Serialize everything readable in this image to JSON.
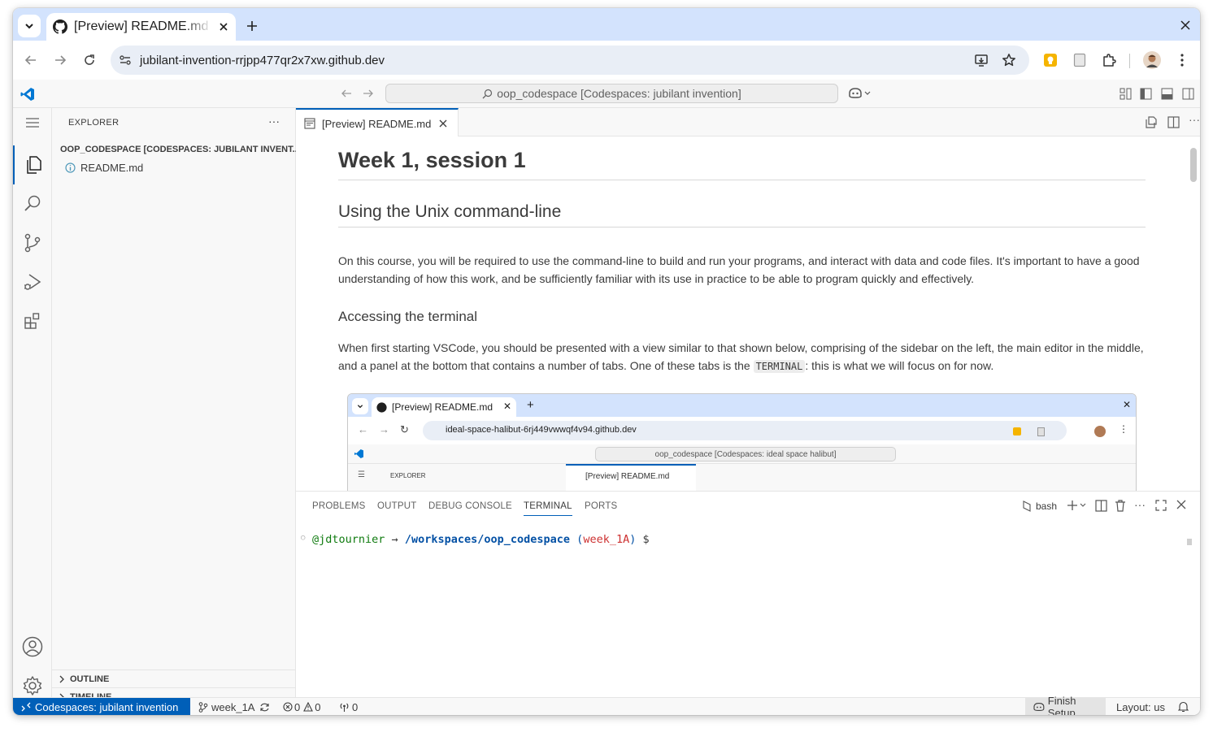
{
  "browser": {
    "tab_title": "[Preview] README.md",
    "url": "jubilant-invention-rrjpp477qr2x7xw.github.dev"
  },
  "vscode": {
    "command_center": "oop_codespace [Codespaces: jubilant invention]",
    "explorer_title": "EXPLORER",
    "folder": "OOP_CODESPACE [CODESPACES: JUBILANT INVENT...",
    "files": [
      "README.md"
    ],
    "outline": "OUTLINE",
    "timeline": "TIMELINE",
    "editor_tab": "[Preview] README.md"
  },
  "document": {
    "h1": "Week 1, session 1",
    "h2": "Using the Unix command-line",
    "p1": "On this course, you will be required to use the command-line to build and run your programs, and interact with data and code files. It's important to have a good understanding of how this work, and be sufficiently familiar with its use in practice to be able to program quickly and effectively.",
    "h3": "Accessing the terminal",
    "p2_before": "When first starting VSCode, you should be presented with a view similar to that shown below, comprising of the sidebar on the left, the main editor in the middle, and a panel at the bottom that contains a number of tabs. One of these tabs is the ",
    "p2_code": "TERMINAL",
    "p2_after": ": this is what we will focus on for now."
  },
  "nested": {
    "tab_title": "[Preview] README.md",
    "url": "ideal-space-halibut-6rj449vwwqf4v94.github.dev",
    "command_center": "oop_codespace [Codespaces: ideal space halibut]",
    "explorer": "EXPLORER",
    "editor_tab": "[Preview] README.md"
  },
  "panel": {
    "tabs": [
      "PROBLEMS",
      "OUTPUT",
      "DEBUG CONSOLE",
      "TERMINAL",
      "PORTS"
    ],
    "active_tab": "TERMINAL",
    "shell": "bash",
    "prompt_user": "@jdtournier",
    "prompt_arrow": "→",
    "prompt_path": "/workspaces/oop_codespace",
    "prompt_branch": "week_1A",
    "prompt_dollar": "$"
  },
  "status": {
    "remote": "Codespaces: jubilant invention",
    "branch": "week_1A",
    "errors": "0",
    "warnings": "0",
    "ports": "0",
    "finish_setup": "Finish Setup",
    "layout": "Layout: us"
  },
  "colors": {
    "accent": "#005fb8",
    "term_user": "#0f7b0f",
    "term_path": "#0451a5",
    "term_branch": "#cd3131"
  }
}
